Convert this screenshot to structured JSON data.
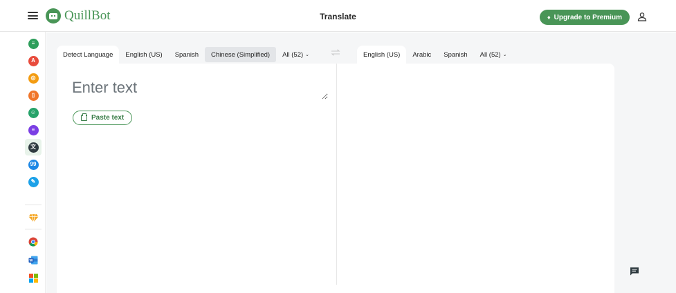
{
  "header": {
    "logo_text": "QuillBot",
    "title": "Translate",
    "premium_button": "Upgrade to Premium",
    "menu_icon": "hamburger-menu-icon",
    "user_icon": "user-profile-icon"
  },
  "sidebar": {
    "items": [
      {
        "name": "paraphraser",
        "icon": "paraphraser-icon",
        "color": "#2e9e5b"
      },
      {
        "name": "grammar-checker",
        "icon": "grammar-checker-icon",
        "color": "#e84b3c"
      },
      {
        "name": "ai-detector",
        "icon": "ai-detector-icon",
        "color": "#f39c12"
      },
      {
        "name": "plagiarism-checker",
        "icon": "plagiarism-checker-icon",
        "color": "#f0762b"
      },
      {
        "name": "ai-humanizer",
        "icon": "ai-humanizer-icon",
        "color": "#27a36a"
      },
      {
        "name": "summarizer",
        "icon": "summarizer-icon",
        "color": "#7b3fe4"
      },
      {
        "name": "translator",
        "icon": "translator-icon",
        "color": "#2f3b40",
        "active": true
      },
      {
        "name": "citation-generator",
        "icon": "citation-generator-icon",
        "color": "#1e88e5"
      },
      {
        "name": "quillbot-flow",
        "icon": "flow-icon",
        "color": "#1ca1e8"
      },
      {
        "name": "premium",
        "icon": "premium-diamond-icon",
        "color": "#f5a623"
      },
      {
        "name": "chrome-extension",
        "icon": "chrome-icon"
      },
      {
        "name": "word-addin",
        "icon": "word-icon"
      },
      {
        "name": "microsoft-edge",
        "icon": "windows-icon"
      }
    ]
  },
  "source": {
    "tabs": [
      {
        "label": "Detect Language",
        "active": true
      },
      {
        "label": "English (US)"
      },
      {
        "label": "Spanish"
      },
      {
        "label": "Chinese (Simplified)",
        "highlighted": true
      },
      {
        "label": "All (52)",
        "dropdown": true
      }
    ],
    "placeholder": "Enter text",
    "paste_button": "Paste text"
  },
  "target": {
    "tabs": [
      {
        "label": "English (US)",
        "active": true
      },
      {
        "label": "Arabic"
      },
      {
        "label": "Spanish"
      },
      {
        "label": "All (52)",
        "dropdown": true
      }
    ]
  },
  "swap_icon": "swap-languages-icon",
  "feedback_icon": "feedback-chat-icon",
  "colors": {
    "brand_green": "#499557",
    "background": "#f5f6f7"
  }
}
